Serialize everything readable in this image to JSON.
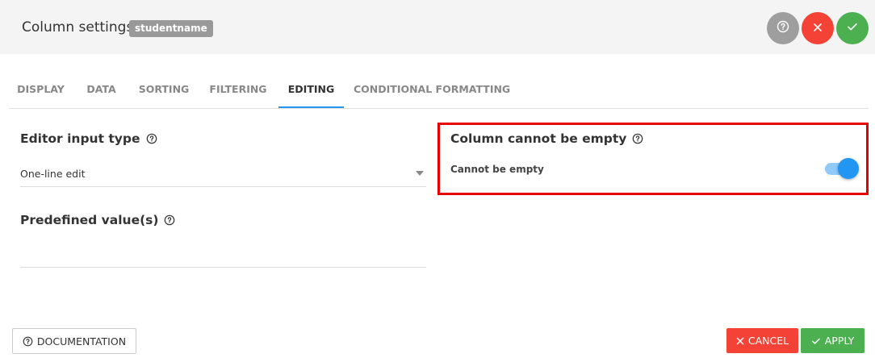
{
  "header": {
    "title": "Column settings:",
    "column_name": "studentname",
    "help_icon": "question-circle-icon",
    "close_icon": "close-icon",
    "confirm_icon": "check-icon"
  },
  "tabs": [
    {
      "label": "DISPLAY",
      "active": false
    },
    {
      "label": "DATA",
      "active": false
    },
    {
      "label": "SORTING",
      "active": false
    },
    {
      "label": "FILTERING",
      "active": false
    },
    {
      "label": "EDITING",
      "active": true
    },
    {
      "label": "CONDITIONAL FORMATTING",
      "active": false
    }
  ],
  "editor": {
    "title": "Editor input type",
    "selected_value": "One-line edit",
    "predefined_title": "Predefined value(s)",
    "predefined_value": ""
  },
  "empty_section": {
    "title": "Column cannot be empty",
    "toggle_label": "Cannot be empty",
    "toggle_on": true
  },
  "footer": {
    "documentation_label": "DOCUMENTATION",
    "cancel_label": "CANCEL",
    "apply_label": "APPLY"
  },
  "colors": {
    "accent": "#2196f3",
    "cancel": "#f44336",
    "apply": "#4caf50",
    "help": "#9e9e9e",
    "highlight_border": "#e60000"
  }
}
